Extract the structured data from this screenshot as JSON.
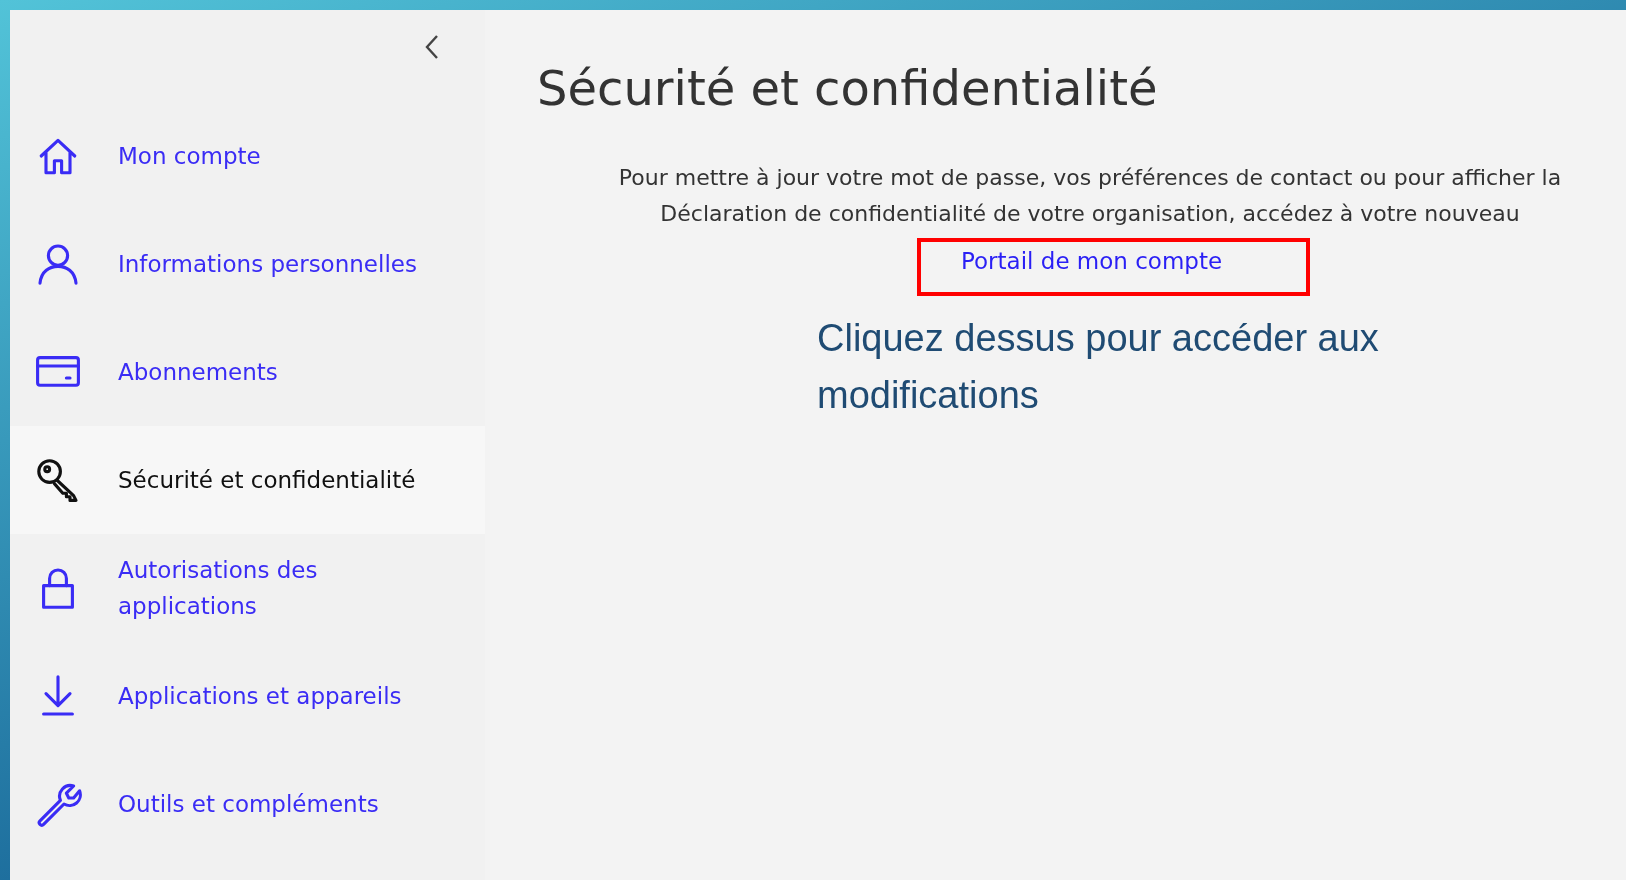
{
  "sidebar": {
    "items": [
      {
        "label": "Mon compte",
        "selected": false
      },
      {
        "label": "Informations personnelles",
        "selected": false
      },
      {
        "label": "Abonnements",
        "selected": false
      },
      {
        "label": "Sécurité et confidentialité",
        "selected": true
      },
      {
        "label": "Autorisations des applications",
        "selected": false
      },
      {
        "label": "Applications et appareils",
        "selected": false
      },
      {
        "label": "Outils et compléments",
        "selected": false
      }
    ]
  },
  "page": {
    "title": "Sécurité et confidentialité",
    "description": "Pour mettre à jour votre mot de passe, vos préférences de contact ou pour afficher la Déclaration de confidentialité de votre organisation, accédez à votre nouveau",
    "link": "Portail de mon compte"
  },
  "annotation": "Cliquez dessus pour accéder aux modifications"
}
